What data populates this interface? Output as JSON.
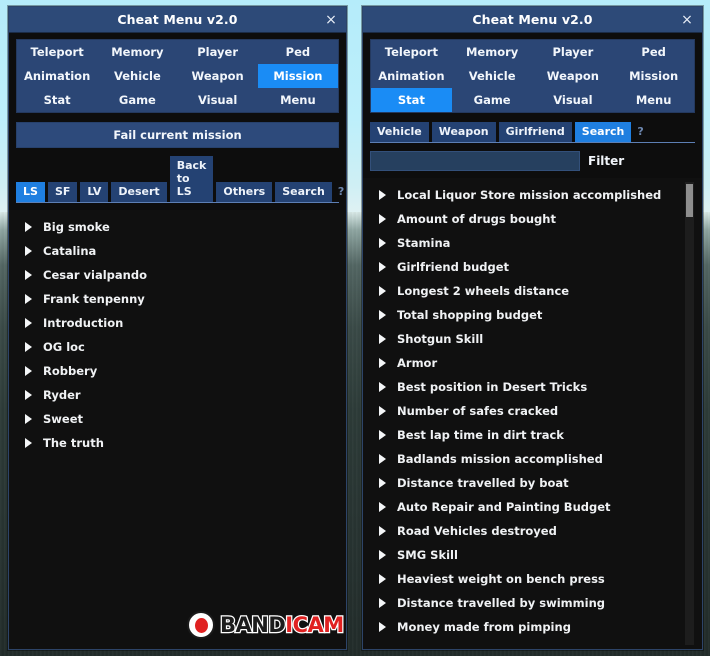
{
  "colors": {
    "accent_active": "#1a8cf5",
    "tab_bg": "#2b4675",
    "titlebar": "#2d4a78",
    "list_bg": "#101010",
    "subtab_active": "#1f7fe0",
    "subtab_bg": "#244273"
  },
  "windows": [
    {
      "id": "left",
      "title": "Cheat Menu v2.0",
      "close_label": "×",
      "tabs": [
        {
          "label": "Teleport",
          "active": false
        },
        {
          "label": "Memory",
          "active": false
        },
        {
          "label": "Player",
          "active": false
        },
        {
          "label": "Ped",
          "active": false
        },
        {
          "label": "Animation",
          "active": false
        },
        {
          "label": "Vehicle",
          "active": false
        },
        {
          "label": "Weapon",
          "active": false
        },
        {
          "label": "Mission",
          "active": true
        },
        {
          "label": "Stat",
          "active": false
        },
        {
          "label": "Game",
          "active": false
        },
        {
          "label": "Visual",
          "active": false
        },
        {
          "label": "Menu",
          "active": false
        }
      ],
      "action_button": "Fail current mission",
      "subtabs": [
        {
          "label": "LS",
          "active": true
        },
        {
          "label": "SF",
          "active": false
        },
        {
          "label": "LV",
          "active": false
        },
        {
          "label": "Desert",
          "active": false
        },
        {
          "label": "Back to LS",
          "active": false
        },
        {
          "label": "Others",
          "active": false
        },
        {
          "label": "Search",
          "active": false
        }
      ],
      "subtab_help": "?",
      "list": [
        "Big smoke",
        "Catalina",
        "Cesar vialpando",
        "Frank tenpenny",
        "Introduction",
        "OG loc",
        "Robbery",
        "Ryder",
        "Sweet",
        "The truth"
      ]
    },
    {
      "id": "right",
      "title": "Cheat Menu v2.0",
      "close_label": "×",
      "tabs": [
        {
          "label": "Teleport",
          "active": false
        },
        {
          "label": "Memory",
          "active": false
        },
        {
          "label": "Player",
          "active": false
        },
        {
          "label": "Ped",
          "active": false
        },
        {
          "label": "Animation",
          "active": false
        },
        {
          "label": "Vehicle",
          "active": false
        },
        {
          "label": "Weapon",
          "active": false
        },
        {
          "label": "Mission",
          "active": false
        },
        {
          "label": "Stat",
          "active": true
        },
        {
          "label": "Game",
          "active": false
        },
        {
          "label": "Visual",
          "active": false
        },
        {
          "label": "Menu",
          "active": false
        }
      ],
      "subtabs": [
        {
          "label": "Vehicle",
          "active": false
        },
        {
          "label": "Weapon",
          "active": false
        },
        {
          "label": "Girlfriend",
          "active": false
        },
        {
          "label": "Search",
          "active": true
        }
      ],
      "subtab_help": "?",
      "filter": {
        "value": "",
        "placeholder": "",
        "label": "Filter"
      },
      "list": [
        "Local Liquor Store mission accomplished",
        "Amount of drugs bought",
        "Stamina",
        "Girlfriend budget",
        "Longest 2 wheels distance",
        "Total shopping budget",
        "Shotgun Skill",
        "Armor",
        "Best position in Desert Tricks",
        "Number of safes cracked",
        "Best lap time in dirt track",
        "Badlands mission accomplished",
        "Distance travelled by boat",
        "Auto Repair and Painting Budget",
        "Road Vehicles destroyed",
        "SMG Skill",
        "Heaviest weight on bench press",
        "Distance travelled by swimming",
        "Money made from pimping"
      ]
    }
  ],
  "watermark": {
    "text_part1": "BAND",
    "text_part2": "ICAM"
  }
}
